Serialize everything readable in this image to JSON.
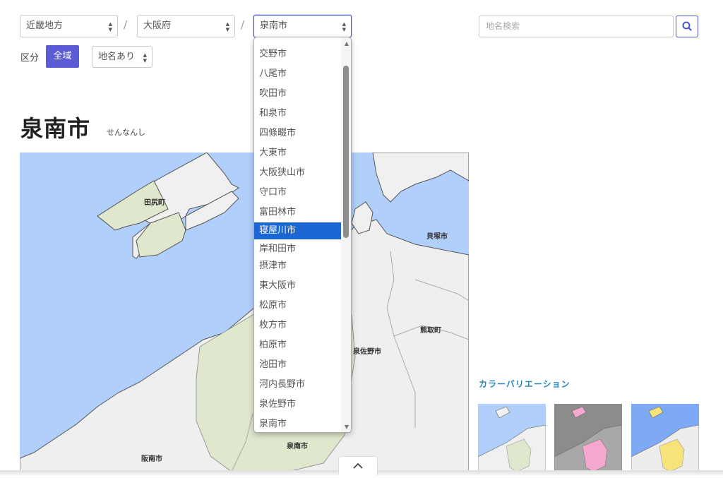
{
  "selectors": {
    "region": "近畿地方",
    "prefecture": "大阪府",
    "city": "泉南市",
    "separator": "/"
  },
  "search": {
    "placeholder": "地名検索",
    "button_icon": "search-icon"
  },
  "kubun": {
    "label": "区分",
    "all_button": "全域",
    "name_select": "地名あり"
  },
  "page": {
    "title": "泉南市",
    "reading": "せんなんし"
  },
  "map": {
    "labels": {
      "tajiri": "田尻町",
      "kaizuka": "貝塚市",
      "kumatori": "熊取町",
      "izumisano": "泉佐野市",
      "sennan": "泉南市",
      "hannan": "阪南市"
    },
    "colors": {
      "sea": "#b0cffa",
      "land": "#f0f0f0",
      "highlight": "#dfe7cc"
    }
  },
  "color_variations": {
    "title": "カラーバリエーション",
    "thumbs": [
      {
        "name": "green",
        "sea": "#b0cffa",
        "land": "#f0f0f0",
        "fill": "#dfe7cc"
      },
      {
        "name": "pink",
        "sea": "#8c8c8c",
        "land": "#a8a8a8",
        "fill": "#f4a8cf"
      },
      {
        "name": "yellow",
        "sea": "#7ea9f5",
        "land": "#ededed",
        "fill": "#f8e27a"
      }
    ]
  },
  "dropdown": {
    "items": [
      "交野市",
      "八尾市",
      "吹田市",
      "和泉市",
      "四條畷市",
      "大東市",
      "大阪狭山市",
      "守口市",
      "富田林市",
      "寝屋川市",
      "岸和田市",
      "摂津市",
      "東大阪市",
      "松原市",
      "枚方市",
      "柏原市",
      "池田市",
      "河内長野市",
      "泉佐野市",
      "泉南市"
    ],
    "highlighted": "寝屋川市"
  },
  "back_to_top": "chevron-up-icon"
}
